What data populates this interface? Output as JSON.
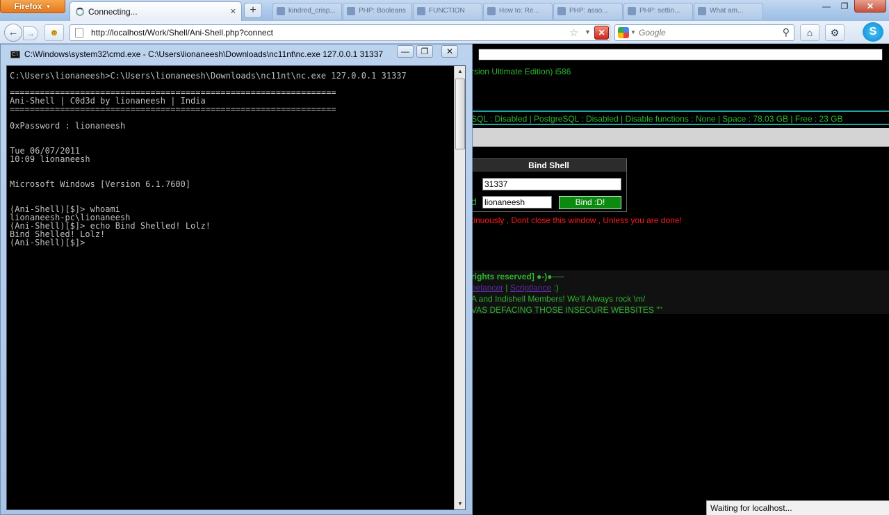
{
  "browser": {
    "menu_button": "Firefox",
    "active_tab": {
      "title": "Connecting..."
    },
    "background_tabs": [
      {
        "title": "kindred_crisp..."
      },
      {
        "title": "PHP: Booleans"
      },
      {
        "title": "FUNCTION"
      },
      {
        "title": "How to: Re..."
      },
      {
        "title": "PHP: asso..."
      },
      {
        "title": "PHP: settin..."
      },
      {
        "title": "What am..."
      }
    ],
    "url": "http://localhost/Work/Shell/Ani-Shell.php?connect",
    "search_placeholder": "Google",
    "status_text": "Waiting for localhost..."
  },
  "cmd_window": {
    "title": "C:\\Windows\\system32\\cmd.exe - C:\\Users\\lionaneesh\\Downloads\\nc11nt\\nc.exe  127.0.0.1 31337",
    "lines": [
      "C:\\Users\\lionaneesh>C:\\Users\\lionaneesh\\Downloads\\nc11nt\\nc.exe 127.0.0.1 31337",
      "",
      "=================================================================",
      "Ani-Shell | C0d3d by lionaneesh | India",
      "=================================================================",
      "",
      "0xPassword : lionaneesh",
      "",
      "",
      "Tue 06/07/2011",
      "10:09 lionaneesh",
      "",
      "",
      "Microsoft Windows [Version 6.1.7600]",
      "",
      "",
      "(Ani-Shell)[$]> whoami",
      "lionaneesh-pc\\lionaneesh",
      "(Ani-Shell)[$]> echo Bind Shelled! Lolz!",
      "Bind Shelled! Lolz!",
      "(Ani-Shell)[$]>"
    ]
  },
  "webpage": {
    "uname_fragment": "rsion Ultimate Edition) i586",
    "info_line": "SQL : Disabled  |  PostgreSQL : Disabled  |  Disable functions : None  |  Space : 78.03 GB  |  Free : 23 GB",
    "bind_shell": {
      "title": "Bind Shell",
      "port_value": "31337",
      "password_value": "lionaneesh",
      "button_label": "Bind :D!",
      "side_label_fragment": "d"
    },
    "warning": "tinuously , Dont close this window , Unless you are done!",
    "footer": {
      "rights": "rights reserved] ●-)●──",
      "link1": "eelancer",
      "separator": "|",
      "link2": "Scriptlance",
      "smiley": ":)",
      "members": "A and Indishell Members! We'll Always rock \\m/",
      "deface": "VAS DEFACING THOSE INSECURE WEBSITES \"\""
    }
  }
}
